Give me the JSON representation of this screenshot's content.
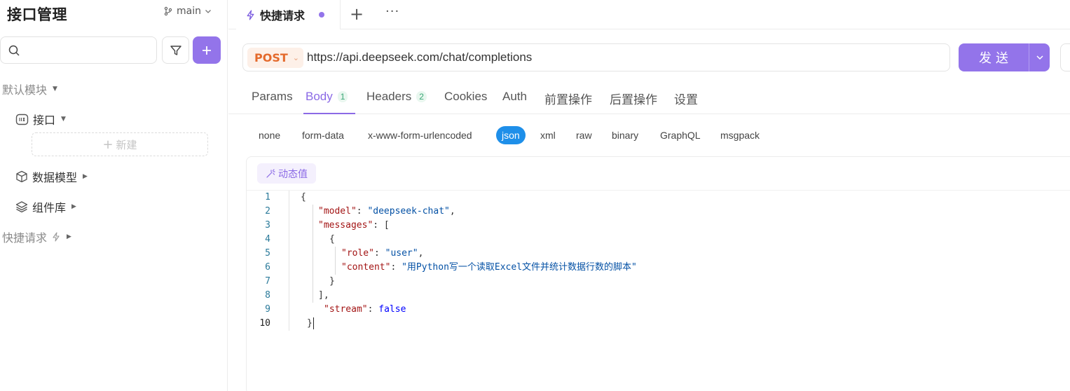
{
  "app": {
    "title": "接口管理",
    "branch": "main"
  },
  "sidebar": {
    "search": {
      "value": "",
      "placeholder": ""
    },
    "items": [
      {
        "label": "默认模块",
        "icon": "none"
      },
      {
        "label": "接口",
        "icon": "api-icon"
      },
      {
        "label": "新建",
        "icon": "plus-icon"
      },
      {
        "label": "数据模型",
        "icon": "cube-icon"
      },
      {
        "label": "组件库",
        "icon": "layers-icon"
      },
      {
        "label": "快捷请求",
        "icon": "bolt-icon"
      }
    ]
  },
  "tabs": {
    "active_label": "快捷请求",
    "add": "+",
    "more": "···"
  },
  "request": {
    "method": "POST",
    "url": "https://api.deepseek.com/chat/completions",
    "send_label": "发送"
  },
  "req_tabs": [
    {
      "label": "Params",
      "badge": ""
    },
    {
      "label": "Body",
      "badge": "1"
    },
    {
      "label": "Headers",
      "badge": "2"
    },
    {
      "label": "Cookies",
      "badge": ""
    },
    {
      "label": "Auth",
      "badge": ""
    },
    {
      "label": "前置操作",
      "badge": ""
    },
    {
      "label": "后置操作",
      "badge": ""
    },
    {
      "label": "设置",
      "badge": ""
    }
  ],
  "body_types": [
    "none",
    "form-data",
    "x-www-form-urlencoded",
    "json",
    "xml",
    "raw",
    "binary",
    "GraphQL",
    "msgpack"
  ],
  "active_body_type": "json",
  "editor": {
    "dynamic_label": "动态值",
    "line_numbers": [
      "1",
      "2",
      "3",
      "4",
      "5",
      "6",
      "7",
      "8",
      "9",
      "10"
    ],
    "code": {
      "l1": "{",
      "model_key": "\"model\"",
      "model_val": "\"deepseek-chat\"",
      "messages_key": "\"messages\"",
      "l3_rest": ": [",
      "l4": "{",
      "role_key": "\"role\"",
      "role_val": "\"user\"",
      "content_key": "\"content\"",
      "content_val": "\"用Python写一个读取Excel文件并统计数据行数的脚本\"",
      "l7": "}",
      "l8": "],",
      "stream_key": "\"stream\"",
      "stream_val": "false",
      "l10": "}"
    }
  },
  "colors": {
    "accent": "#9374ea",
    "method": "#e46a2c",
    "json_active": "#1e8fe9"
  }
}
